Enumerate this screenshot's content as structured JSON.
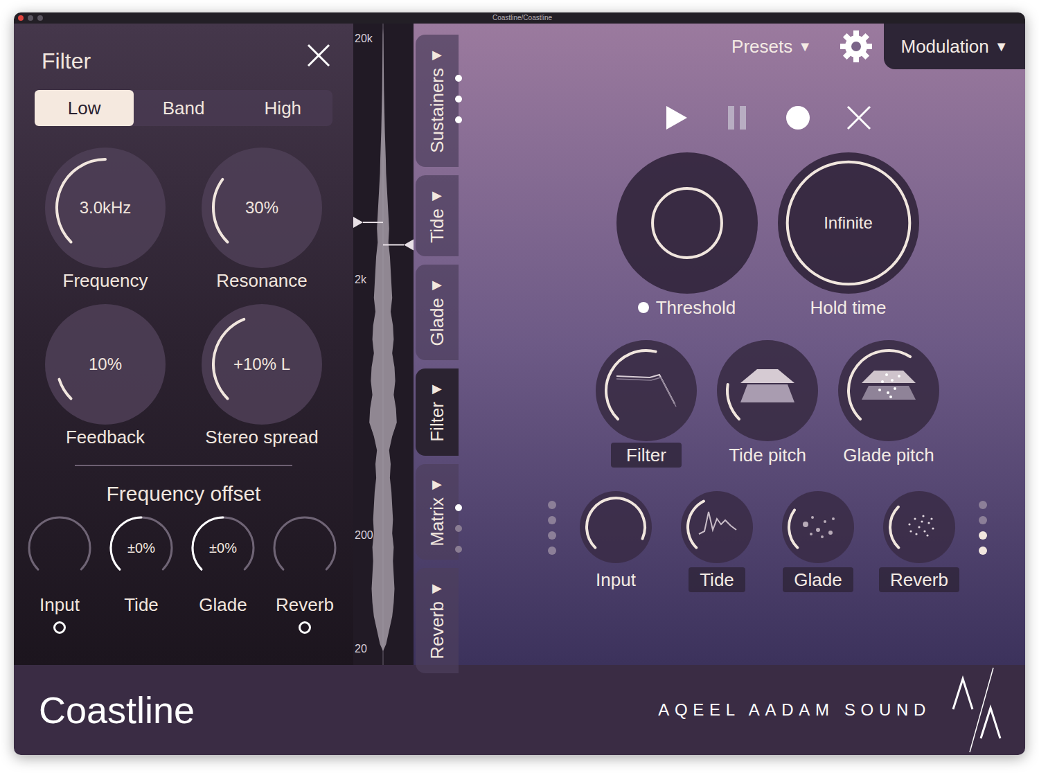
{
  "window": {
    "title": "Coastline/Coastline"
  },
  "filter_panel": {
    "title": "Filter",
    "modes": [
      {
        "label": "Low",
        "selected": true
      },
      {
        "label": "Band",
        "selected": false
      },
      {
        "label": "High",
        "selected": false
      }
    ],
    "knobs": [
      {
        "label": "Frequency",
        "value": "3.0kHz",
        "level": 0.5
      },
      {
        "label": "Resonance",
        "value": "30%",
        "level": 0.3
      },
      {
        "label": "Feedback",
        "value": "10%",
        "level": 0.1
      },
      {
        "label": "Stereo spread",
        "value": "+10% L",
        "level": 0.42
      }
    ],
    "offset": {
      "title": "Frequency offset",
      "knobs": [
        {
          "label": "Input",
          "level": 0,
          "kind": "toggle",
          "on": false
        },
        {
          "label": "Tide",
          "value": "±0%",
          "level": 0.5,
          "kind": "plain"
        },
        {
          "label": "Glade",
          "value": "±0%",
          "level": 0.5,
          "kind": "plain"
        },
        {
          "label": "Reverb",
          "level": 0,
          "kind": "toggle",
          "on": false
        }
      ]
    }
  },
  "spectrum": {
    "ticks": [
      "20k",
      "2k",
      "200",
      "20"
    ],
    "values": [
      0.02,
      0.03,
      0.04,
      0.05,
      0.06,
      0.08,
      0.1,
      0.12,
      0.15,
      0.18,
      0.2,
      0.25,
      0.3,
      0.35,
      0.4,
      0.35,
      0.45,
      0.5,
      0.55,
      0.6,
      0.5,
      0.65,
      0.7,
      0.6,
      0.75,
      0.8,
      0.7,
      0.85,
      0.9,
      0.6,
      0.4,
      0.5,
      0.45,
      0.55,
      0.6,
      0.65,
      0.6,
      0.7,
      0.65,
      0.7,
      0.75,
      0.7,
      0.6,
      0.4,
      0.2
    ],
    "markers": [
      {
        "side": "left",
        "level": 0.69
      },
      {
        "side": "right",
        "level": 0.655
      }
    ]
  },
  "tabs": [
    {
      "label": "Sustainers",
      "arrow": "▶",
      "selected": false,
      "dots": [
        true,
        true,
        true
      ]
    },
    {
      "label": "Tide",
      "arrow": "▶",
      "selected": false,
      "dots": []
    },
    {
      "label": "Glade",
      "arrow": "▶",
      "selected": false,
      "dots": []
    },
    {
      "label": "Filter",
      "arrow": "▶",
      "selected": true,
      "dots": []
    },
    {
      "label": "Matrix",
      "arrow": "▶",
      "selected": false,
      "dots": [
        true,
        false,
        false
      ]
    },
    {
      "label": "Reverb",
      "arrow": "▶",
      "selected": false,
      "dots": []
    }
  ],
  "top_bar": {
    "presets": "Presets",
    "modulation": "Modulation",
    "arrow": "▼"
  },
  "main_knobs": [
    {
      "label": "Threshold",
      "value": "",
      "level": 0.52,
      "dot": true
    },
    {
      "label": "Hold time",
      "value": "Infinite",
      "level": 0.92,
      "dot": false
    }
  ],
  "module_knobs": [
    {
      "label": "Filter",
      "level": 0.55,
      "highlighted": true
    },
    {
      "label": "Tide pitch",
      "level": 0.2,
      "highlighted": false
    },
    {
      "label": "Glade pitch",
      "level": 0.62,
      "highlighted": false
    }
  ],
  "source_knobs": [
    {
      "label": "Input",
      "level": 0.92,
      "highlighted": false
    },
    {
      "label": "Tide",
      "level": 0.4,
      "highlighted": true
    },
    {
      "label": "Glade",
      "level": 0.3,
      "highlighted": true
    },
    {
      "label": "Reverb",
      "level": 0.33,
      "highlighted": true
    }
  ],
  "source_dots": {
    "left": [
      false,
      false,
      false,
      false
    ],
    "right": [
      false,
      false,
      true,
      true
    ]
  },
  "footer": {
    "brand": "Coastline",
    "maker": "AQEEL AADAM SOUND"
  }
}
